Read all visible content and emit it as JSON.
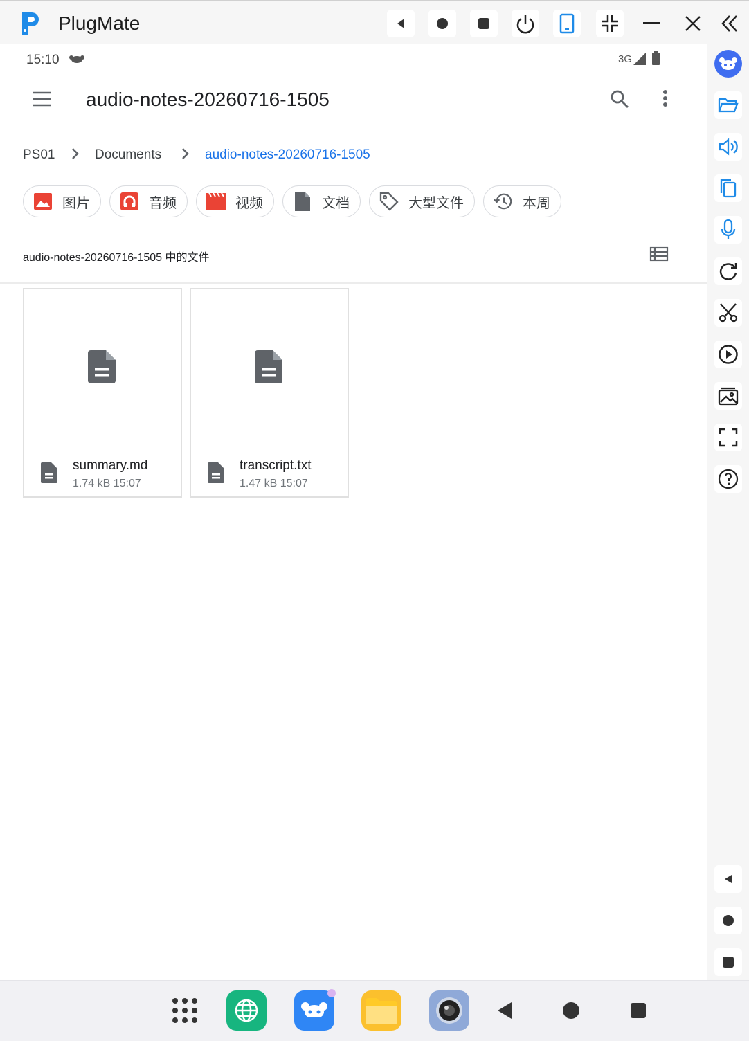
{
  "window": {
    "title": "PlugMate",
    "controls": [
      "back-triangle-icon",
      "home-circle-icon",
      "stop-square-icon",
      "power-icon",
      "phone-icon",
      "shrink-icon",
      "minimize-icon",
      "close-icon",
      "collapse-double-chevron-icon"
    ]
  },
  "status_bar": {
    "time": "15:10",
    "network": "3G"
  },
  "app_bar": {
    "title": "audio-notes-20260716-1505"
  },
  "breadcrumb": [
    "PS01",
    "Documents",
    "audio-notes-20260716-1505"
  ],
  "filters": [
    {
      "label": "图片",
      "icon": "image-icon",
      "color": "#ea4335"
    },
    {
      "label": "音频",
      "icon": "headphones-icon",
      "color": "#ea4335"
    },
    {
      "label": "视频",
      "icon": "clapperboard-icon",
      "color": "#ea4335"
    },
    {
      "label": "文档",
      "icon": "document-icon",
      "color": "#5f6368"
    },
    {
      "label": "大型文件",
      "icon": "tag-icon",
      "color": "#5f6368"
    },
    {
      "label": "本周",
      "icon": "history-icon",
      "color": "#5f6368"
    }
  ],
  "section": {
    "label": "audio-notes-20260716-1505 中的文件"
  },
  "files": [
    {
      "name": "summary.md",
      "meta": "1.74 kB 15:07"
    },
    {
      "name": "transcript.txt",
      "meta": "1.47 kB 15:07"
    }
  ],
  "sidebar": [
    "app-store-icon",
    "folder-icon",
    "volume-icon",
    "copy-icon",
    "microphone-icon",
    "rotate-icon",
    "scissors-icon",
    "play-circle-icon",
    "gallery-icon",
    "fullscreen-icon",
    "help-icon",
    "back-triangle-icon",
    "home-circle-icon",
    "stop-square-icon"
  ],
  "taskbar": [
    "app-drawer-icon",
    "browser-icon",
    "app-store-icon",
    "files-icon",
    "camera-icon",
    "back-icon",
    "home-icon",
    "recents-icon"
  ],
  "colors": {
    "accent": "#1a73e8",
    "window_bg": "#f6f6f6",
    "icon_blue": "#1f8be8"
  }
}
